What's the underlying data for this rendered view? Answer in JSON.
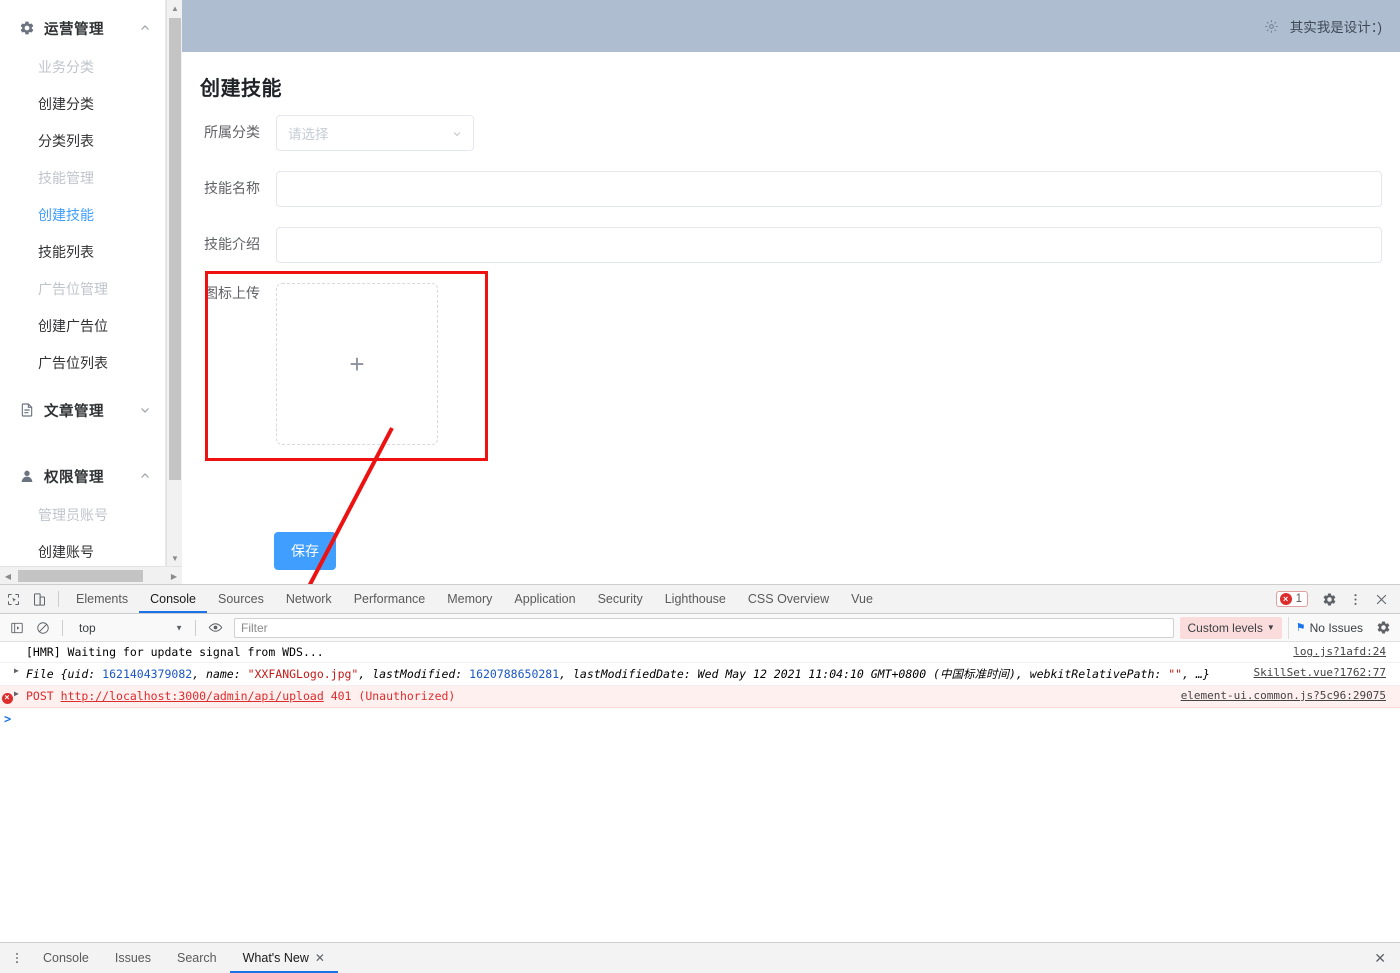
{
  "app": {
    "header": {
      "gear_icon": "gear-icon",
      "brand_text": "其实我是设计：)"
    }
  },
  "sidebar": {
    "groups": [
      {
        "icon": "gear-icon",
        "label": "运营管理",
        "chevron": "chevron-up-icon",
        "items": [
          {
            "label": "业务分类",
            "state": "muted"
          },
          {
            "label": "创建分类",
            "state": "normal"
          },
          {
            "label": "分类列表",
            "state": "normal"
          },
          {
            "label": "技能管理",
            "state": "muted"
          },
          {
            "label": "创建技能",
            "state": "active"
          },
          {
            "label": "技能列表",
            "state": "normal"
          },
          {
            "label": "广告位管理",
            "state": "muted"
          },
          {
            "label": "创建广告位",
            "state": "normal"
          },
          {
            "label": "广告位列表",
            "state": "normal"
          }
        ]
      },
      {
        "icon": "document-icon",
        "label": "文章管理",
        "chevron": "chevron-down-icon",
        "items": []
      },
      {
        "icon": "user-icon",
        "label": "权限管理",
        "chevron": "chevron-up-icon",
        "items": [
          {
            "label": "管理员账号",
            "state": "muted"
          },
          {
            "label": "创建账号",
            "state": "normal"
          }
        ]
      }
    ]
  },
  "form": {
    "title": "创建技能",
    "fields": {
      "category_label": "所属分类",
      "category_placeholder": "请选择",
      "category_value": "",
      "name_label": "技能名称",
      "name_value": "",
      "intro_label": "技能介绍",
      "intro_value": "",
      "upload_label": "图标上传",
      "upload_plus": "+"
    },
    "save_label": "保存"
  },
  "annotation": {
    "rect_color": "#ee1111",
    "arrow_color": "#ee1111"
  },
  "devtools": {
    "tabs": [
      "Elements",
      "Console",
      "Sources",
      "Network",
      "Performance",
      "Memory",
      "Application",
      "Security",
      "Lighthouse",
      "CSS Overview",
      "Vue"
    ],
    "active_tab": "Console",
    "error_count": "1",
    "console_toolbar": {
      "context": "top",
      "filter_placeholder": "Filter",
      "filter_value": "",
      "levels_label": "Custom levels",
      "issues_label": "No Issues"
    },
    "messages": [
      {
        "kind": "info",
        "text": "[HMR] Waiting for update signal from WDS...",
        "source": "log.js?1afd:24"
      },
      {
        "kind": "object",
        "prefix": "File {uid: ",
        "uid": "1621404379082",
        "name_key": ", name: ",
        "name_value": "\"XXFANGLogo.jpg\"",
        "lm_key": ", lastModified: ",
        "lm_value": "1620788650281",
        "lmd_key": ", lastModifiedDate: ",
        "lmd_value": "Wed May 12 2021 11:04:10 GMT+0800 (中国标准时间)",
        "rel_key": ", webkitRelativePath: ",
        "rel_value": "\"\"",
        "suffix": ", …}",
        "source": "SkillSet.vue?1762:77"
      },
      {
        "kind": "error",
        "method": "POST",
        "url": "http://localhost:3000/admin/api/upload",
        "status": "401",
        "status_text": "(Unauthorized)",
        "source": "element-ui.common.js?5c96:29075"
      }
    ],
    "prompt_caret": ">",
    "drawer": {
      "tabs": [
        "Console",
        "Issues",
        "Search",
        "What's New"
      ],
      "active_tab": "What's New",
      "close_icon": "close-icon"
    }
  }
}
